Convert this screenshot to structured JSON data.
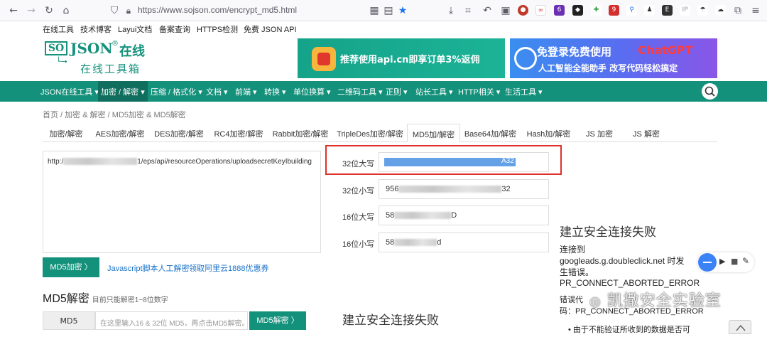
{
  "browser": {
    "url": "https://www.sojson.com/encrypt_md5.html"
  },
  "topnav": [
    "在线工具",
    "技术博客",
    "Layui文档",
    "备案查询",
    "HTTPS检测",
    "免费 JSON API"
  ],
  "logo": {
    "brand": "SO JSON",
    "suffix": "在线",
    "tagline": "在线工具箱"
  },
  "banners": {
    "left": "推荐使用api.cn即享订单3%返佣",
    "right_title_a": "免登录免费使用",
    "right_title_b": "ChatGPT",
    "right_sub": "人工智能全能助手 改写代码轻松搞定"
  },
  "mainnav": [
    "JSON在线工具",
    "加密 / 解密",
    "压缩 / 格式化",
    "文档",
    "前端",
    "转换",
    "单位换算",
    "二维码工具",
    "正则",
    "站长工具",
    "HTTP相关",
    "生活工具"
  ],
  "breadcrumb": "首页 / 加密 & 解密 / MD5加密 & MD5解密",
  "tabs": [
    "加密/解密",
    "AES加密/解密",
    "DES加密/解密",
    "RC4加密/解密",
    "Rabbit加密/解密",
    "TripleDes加密/解密",
    "MD5加/解密",
    "Base64加/解密",
    "Hash加/解密",
    "JS 加密",
    "JS 解密"
  ],
  "input": {
    "prefix": "http:/",
    "suffix": "1/eps/api/resourceOperations/uploadsecretKeyIbuilding"
  },
  "actions": {
    "encrypt": "MD5加密 〉",
    "link1": "Javascript脚本人工解密",
    "link2": "领取阿里云1888优惠券"
  },
  "results": [
    {
      "label": "32位大写",
      "visible_tail": "A32"
    },
    {
      "label": "32位小写",
      "visible_head": "956",
      "visible_tail": "32"
    },
    {
      "label": "16位大写",
      "visible_head": "58",
      "visible_tail": "D"
    },
    {
      "label": "16位小写",
      "visible_head": "58",
      "visible_tail": "d"
    }
  ],
  "decrypt": {
    "title": "MD5解密",
    "hint": "目前只能解密1~8位数字",
    "label": "MD5",
    "placeholder": "在这里输入16 & 32位 MD5，再点击MD5解密。",
    "button": "MD5解密 〉"
  },
  "error": {
    "title": "建立安全连接失败",
    "line1": "连接到",
    "line2": "googleads.g.doubleclick.net 时发",
    "line3": "生错误。",
    "line4": "PR_CONNECT_ABORTED_ERROR",
    "line5": "错误代",
    "line6": "码：PR_CONNECT_ABORTED_ERROR",
    "bullet": "• 由于不能验证所收到的数据是否可"
  },
  "error2_title": "建立安全连接失败",
  "watermark": "凯撒安全实验室",
  "colors": {
    "brand_green": "#14917b",
    "highlight_red": "#e0302a",
    "link_blue": "#1a73c9"
  }
}
